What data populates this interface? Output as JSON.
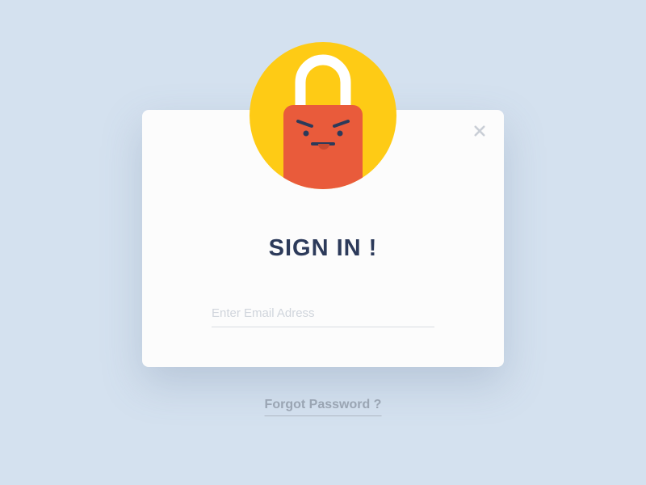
{
  "modal": {
    "title": "SIGN IN !",
    "email_placeholder": "Enter Email Adress",
    "email_value": ""
  },
  "forgot_password_label": "Forgot Password ?",
  "colors": {
    "background": "#d4e1ef",
    "card": "#fcfcfc",
    "title_text": "#2c3a5a",
    "placeholder": "#d0d5dc",
    "link": "#9aa5b3",
    "avatar_circle": "#fecb15",
    "lock_body": "#e95b3b",
    "lock_shackle": "#ffffff",
    "close_icon": "#c9ced6"
  }
}
